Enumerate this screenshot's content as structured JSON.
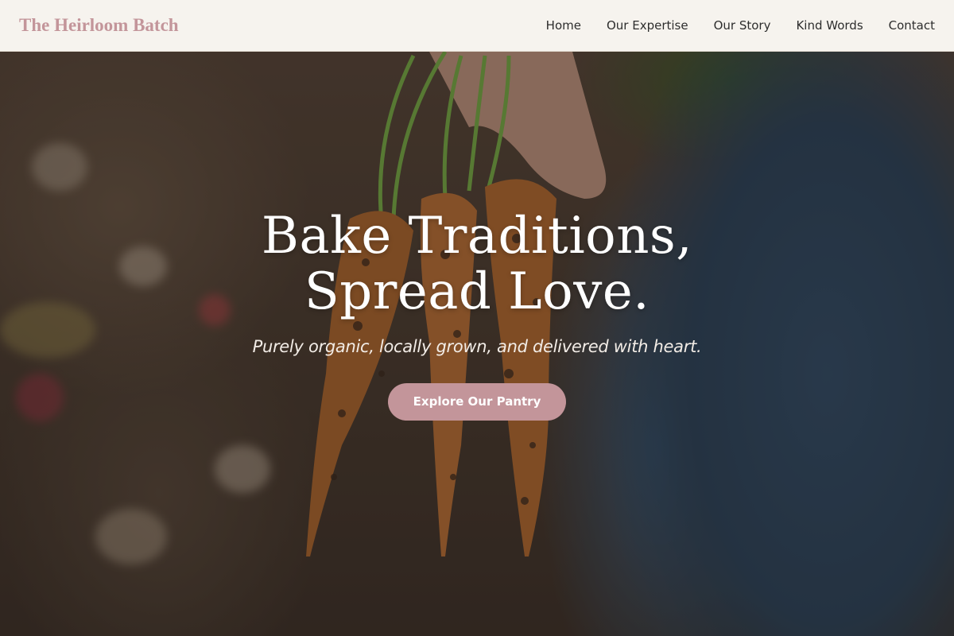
{
  "header": {
    "brand": "The Heirloom Batch",
    "nav": [
      {
        "label": "Home"
      },
      {
        "label": "Our Expertise"
      },
      {
        "label": "Our Story"
      },
      {
        "label": "Kind Words"
      },
      {
        "label": "Contact"
      }
    ]
  },
  "hero": {
    "headline_line1": "Bake Traditions,",
    "headline_line2": "Spread Love.",
    "tagline": "Purely organic, locally grown, and delivered with heart.",
    "cta_label": "Explore Our Pantry",
    "image_subject": "hand-holding-fresh-carrots"
  },
  "colors": {
    "accent": "#c3959a",
    "header_bg": "#f6f3ee",
    "nav_text": "#2d2d2d",
    "hero_text": "#ffffff"
  }
}
